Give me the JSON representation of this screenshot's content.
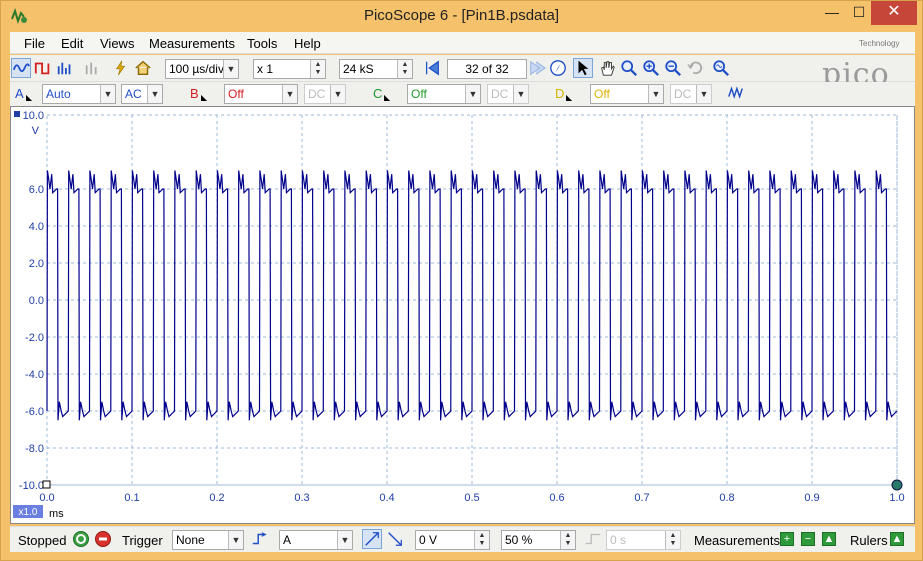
{
  "window": {
    "title": "PicoScope 6 - [Pin1B.psdata]"
  },
  "menu": [
    "File",
    "Edit",
    "Views",
    "Measurements",
    "Tools",
    "Help"
  ],
  "toolbar": {
    "timebase": "100 µs/div",
    "zoom": "x 1",
    "samples": "24 kS",
    "capture": "32 of 32"
  },
  "logo": {
    "text": "pico",
    "sub": "Technology"
  },
  "channels": [
    {
      "name": "A",
      "range": "Auto",
      "coupling": "AC",
      "color": "#1f4fc7"
    },
    {
      "name": "B",
      "range": "Off",
      "coupling": "DC",
      "color": "#d42020"
    },
    {
      "name": "C",
      "range": "Off",
      "coupling": "DC",
      "color": "#1f9a2a"
    },
    {
      "name": "D",
      "range": "Off",
      "coupling": "DC",
      "color": "#d8b400"
    }
  ],
  "plot": {
    "y_unit": "V",
    "x_unit": "ms",
    "x_multiplier": "x1.0",
    "trace_color": "#00008b"
  },
  "chart_data": {
    "type": "line",
    "title": "",
    "xlabel": "ms",
    "ylabel": "V",
    "xlim": [
      0.0,
      1.0
    ],
    "ylim": [
      -10.0,
      10.0
    ],
    "x_ticks": [
      "0.0",
      "0.1",
      "0.2",
      "0.3",
      "0.4",
      "0.5",
      "0.6",
      "0.7",
      "0.8",
      "0.9",
      "1.0"
    ],
    "y_ticks": [
      "10.0",
      "6.0",
      "4.0",
      "2.0",
      "0.0",
      "-2.0",
      "-4.0",
      "-6.0",
      "-8.0",
      "-10.0"
    ],
    "grid": true,
    "series": [
      {
        "waveform": "square",
        "cycles": 40,
        "high_v": 6.0,
        "low_v": -6.0,
        "peak_high_v": 7.0,
        "peak_low_v": -6.5,
        "duty": 0.5
      }
    ]
  },
  "status": {
    "state": "Stopped",
    "trigger_label": "Trigger",
    "trigger_mode": "None",
    "trigger_channel": "A",
    "trigger_level": "0 V",
    "pre_trigger": "50 %",
    "delay": "0 s",
    "measurements_label": "Measurements",
    "rulers_label": "Rulers"
  }
}
